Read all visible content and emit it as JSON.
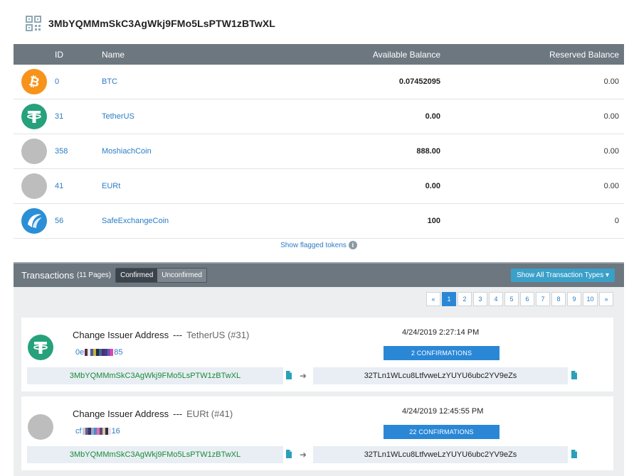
{
  "address": {
    "title": "3MbYQMMmSkC3AgWkj9FMo5LsPTW1zBTwXL",
    "icon": "qr-code-icon"
  },
  "balances": {
    "headers": {
      "id": "ID",
      "name": "Name",
      "available": "Available Balance",
      "reserved": "Reserved Balance"
    },
    "rows": [
      {
        "icon": "bitcoin-icon",
        "id": "0",
        "name": "BTC",
        "available": "0.07452095",
        "reserved": "0.00"
      },
      {
        "icon": "tether-icon",
        "id": "31",
        "name": "TetherUS",
        "available": "0.00",
        "reserved": "0.00"
      },
      {
        "icon": "placeholder-coin-icon",
        "id": "358",
        "name": "MoshiachCoin",
        "available": "888.00",
        "reserved": "0.00"
      },
      {
        "icon": "placeholder-coin-icon",
        "id": "41",
        "name": "EURt",
        "available": "0.00",
        "reserved": "0.00"
      },
      {
        "icon": "safeexchange-coin-icon",
        "id": "56",
        "name": "SafeExchangeCoin",
        "available": "100",
        "reserved": "0"
      }
    ],
    "flagged_link": "Show flagged tokens",
    "flagged_icon": "info-icon"
  },
  "transactions": {
    "title": "Transactions",
    "pages_label": "(11 Pages)",
    "tabs": [
      {
        "label": "Confirmed",
        "active": true
      },
      {
        "label": "Unconfirmed",
        "active": false
      }
    ],
    "types_button": "Show All Transaction Types ▾",
    "pager": {
      "prev": "«",
      "next": "»",
      "pages": [
        "1",
        "2",
        "3",
        "4",
        "5",
        "6",
        "7",
        "8",
        "9",
        "10"
      ],
      "active": "1"
    },
    "items": [
      {
        "coin_icon": "tether-icon",
        "type": "Change Issuer Address",
        "separator": "---",
        "token": "TetherUS (#31)",
        "hash_start": "0e",
        "hash_end": "85",
        "hash_colors": [
          "#5a2f4a",
          "#e8e8e8",
          "#4a5aa0",
          "#c9b23a",
          "#262a3a",
          "#3a6a9a",
          "#5a2a6a",
          "#2a4a8a",
          "#8a4ac0",
          "#e04aa0"
        ],
        "time": "4/24/2019 2:27:14 PM",
        "confirmations": "2 CONFIRMATIONS",
        "from": "3MbYQMMmSkC3AgWkj9FMo5LsPTW1zBTwXL",
        "to": "32TLn1WLcu8LtfvweLzYUYU6ubc2YV9eZs",
        "arrow": "➜"
      },
      {
        "coin_icon": "placeholder-coin-icon",
        "type": "Change Issuer Address",
        "separator": "---",
        "token": "EURt (#41)",
        "hash_start": "cf",
        "hash_end": "16",
        "hash_colors": [
          "#c8c8d8",
          "#6a5a8a",
          "#2a3a6a",
          "#a8a0c0",
          "#4a8ad0",
          "#e86ab0",
          "#5a4a7a",
          "#d0c8a0",
          "#3a2a4a",
          "#e8e0e8"
        ],
        "time": "4/24/2019 12:45:55 PM",
        "confirmations": "22 CONFIRMATIONS",
        "from": "3MbYQMMmSkC3AgWkj9FMo5LsPTW1zBTwXL",
        "to": "32TLn1WLcu8LtfvweLzYUYU6ubc2YV9eZs",
        "arrow": "➜"
      }
    ]
  },
  "colors": {
    "header_bar": "#6d7780",
    "link": "#2a7dc4",
    "confirm_badge": "#2a87d6",
    "from_address": "#1a8a3a",
    "types_button": "#3aa0c9"
  }
}
